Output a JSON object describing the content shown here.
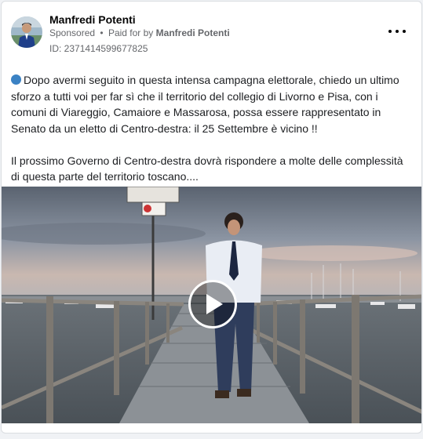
{
  "post": {
    "author_name": "Manfredi Potenti",
    "sponsored_label": "Sponsored",
    "separator": "•",
    "paid_for_by_label": "Paid for by",
    "payer_name": "Manfredi Potenti",
    "ad_id": "ID: 2371414599677825",
    "more_icon": "more-options-icon",
    "paragraph_1_icon": "blue-circle-emoji",
    "paragraph_1": "Dopo avermi seguito in questa intensa campagna elettorale, chiedo un ultimo sforzo a tutti voi per far sì che il territorio del collegio di Livorno e Pisa, con i comuni di Viareggio, Camaiore e Massarosa, possa essere rappresentato in Senato da un eletto di Centro-destra: il 25 Settembre è vicino !!",
    "paragraph_2": "Il prossimo Governo di Centro-destra dovrà rispondere a molte delle complessità di questa parte del territorio toscano....",
    "media": {
      "type": "video",
      "play_icon": "play-icon"
    }
  },
  "colors": {
    "name": "#050505",
    "meta": "#65676b",
    "body_text": "#1c1e21",
    "blue_dot": "#3b82c4",
    "card_border": "#dadde1"
  }
}
